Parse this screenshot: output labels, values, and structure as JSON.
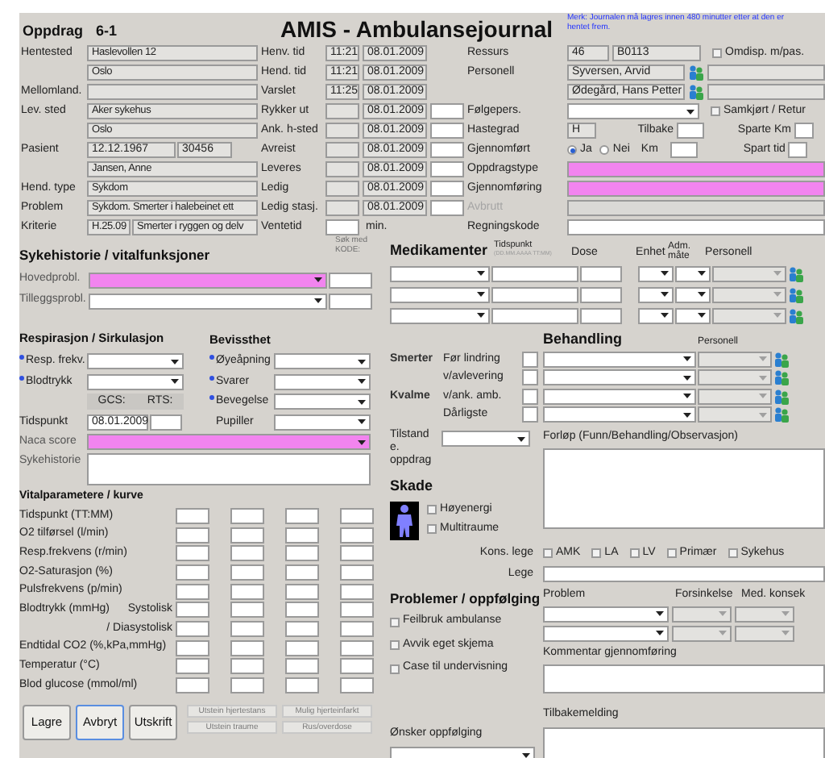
{
  "header": {
    "assignment_label": "Oppdrag",
    "assignment_number": "6-1",
    "title": "AMIS - Ambulansejournal",
    "note": "Merk: Journalen må lagres innen 480 minutter etter at den er hentet frem."
  },
  "location_rows": [
    {
      "kind": "text",
      "label": "Hentested",
      "values": [
        "Haslevollen  12"
      ]
    },
    {
      "kind": "text",
      "values": [
        "Oslo"
      ]
    },
    {
      "kind": "text",
      "label": "Mellomland."
    },
    {
      "kind": "text",
      "label": "Lev. sted",
      "values": [
        "Aker sykehus"
      ]
    },
    {
      "kind": "text",
      "values": [
        "Oslo"
      ]
    },
    {
      "kind": "pair",
      "label": "Pasient",
      "values": [
        "12.12.1967",
        "30456"
      ]
    },
    {
      "kind": "text",
      "values": [
        "Jansen, Anne"
      ]
    },
    {
      "kind": "text",
      "label": "Hend. type",
      "values": [
        "Sykdom"
      ]
    },
    {
      "kind": "text",
      "label": "Problem",
      "values": [
        "Sykdom. Smerter i halebeinet ett"
      ]
    },
    {
      "kind": "code",
      "label": "Kriterie",
      "values": [
        "H.25.09",
        "Smerter i ryggen og delv"
      ]
    }
  ],
  "time_rows": [
    {
      "kind": "timestamp",
      "label": "Henv. tid",
      "time": "11:21",
      "date": "08.01.2009"
    },
    {
      "kind": "timestamp",
      "label": "Hend. tid",
      "time": "11:21",
      "date": "08.01.2009"
    },
    {
      "kind": "timestamp",
      "label": "Varslet",
      "time": "11:25",
      "date": "08.01.2009"
    },
    {
      "kind": "timestamp_input",
      "label": "Rykker ut",
      "date": "08.01.2009"
    },
    {
      "kind": "timestamp_input",
      "label": "Ank. h-sted",
      "date": "08.01.2009"
    },
    {
      "kind": "timestamp_input",
      "label": "Avreist",
      "date": "08.01.2009"
    },
    {
      "kind": "timestamp_input",
      "label": "Leveres",
      "date": "08.01.2009"
    },
    {
      "kind": "timestamp_input",
      "label": "Ledig",
      "date": "08.01.2009"
    },
    {
      "kind": "timestamp_input",
      "label": "Ledig stasj.",
      "date": "08.01.2009"
    },
    {
      "kind": "duration",
      "label": "Ventetid",
      "unit": "min."
    }
  ],
  "resource": {
    "label": "Ressurs",
    "values": [
      "46",
      "B0113"
    ],
    "checkbox": {
      "label": "Omdisp. m/pas.",
      "checked": false
    }
  },
  "personnel": {
    "label": "Personell",
    "members": [
      "Syversen, Arvid",
      "Ødegård, Hans Petter"
    ]
  },
  "companion": {
    "label": "Følgepers.",
    "checkbox": {
      "label": "Samkjørt / Retur",
      "checked": false
    }
  },
  "urgency": {
    "label": "Hastegrad",
    "value": "H",
    "return_label": "Tilbake",
    "saved_km_label": "Sparte Km"
  },
  "completed": {
    "label": "Gjennomført",
    "options": [
      {
        "label": "Ja",
        "selected": true
      },
      {
        "label": "Nei",
        "selected": false
      }
    ],
    "km_label": "Km",
    "saved_time_label": "Spart tid"
  },
  "assignment_fields": [
    {
      "label": "Oppdragstype",
      "required": true,
      "disabled": false
    },
    {
      "label": "Gjennomføring",
      "required": true,
      "disabled": false
    },
    {
      "label": "Avbrutt",
      "required": false,
      "disabled": true
    },
    {
      "label": "Regningskode",
      "required": false,
      "disabled": false
    }
  ],
  "history": {
    "title": "Sykehistorie / vitalfunksjoner",
    "code_hint": "Søk med KODE:",
    "problems": [
      {
        "label": "Hovedprobl.",
        "required": true
      },
      {
        "label": "Tilleggsprobl.",
        "required": false
      }
    ]
  },
  "respiration": {
    "title": "Respirasjon / Sirkulasjon",
    "fields": [
      {
        "label": "Resp. frekv.",
        "starred": true
      },
      {
        "label": "Blodtrykk",
        "starred": true
      }
    ],
    "gcs_label": "GCS:",
    "rts_label": "RTS:",
    "time_label": "Tidspunkt",
    "time_date": "08.01.2009"
  },
  "consciousness": {
    "title": "Bevissthet",
    "fields": [
      {
        "label": "Øyeåpning",
        "starred": true
      },
      {
        "label": "Svarer",
        "starred": true
      },
      {
        "label": "Bevegelse",
        "starred": true
      },
      {
        "label": "Pupiller",
        "starred": false
      }
    ]
  },
  "naca": {
    "label": "Naca score",
    "required": true
  },
  "history_text": {
    "label": "Sykehistorie"
  },
  "vitals": {
    "title": "Vitalparametere / kurve",
    "rows": [
      {
        "label": "Tidspunkt (TT:MM)"
      },
      {
        "label": "O2 tilførsel (l/min)"
      },
      {
        "label": "Resp.frekvens (r/min)"
      },
      {
        "label": "O2-Saturasjon (%)"
      },
      {
        "label": "Pulsfrekvens (p/min)"
      },
      {
        "label": "Blodtrykk (mmHg)",
        "sublabel": "Systolisk"
      },
      {
        "sublabel": "/ Diasystolisk"
      },
      {
        "label": "Endtidal CO2 (%,kPa,mmHg)"
      },
      {
        "label": "Temperatur (°C)"
      },
      {
        "label": "Blod glucose (mmol/ml)"
      }
    ]
  },
  "buttons": [
    {
      "label": "Lagre",
      "focused": false
    },
    {
      "label": "Avbryt",
      "focused": true
    },
    {
      "label": "Utskrift",
      "focused": false
    }
  ],
  "form_buttons": [
    {
      "label": "Utstein hjertestans",
      "disabled": true
    },
    {
      "label": "Mulig hjerteinfarkt",
      "disabled": true
    },
    {
      "label": "Utstein traume",
      "disabled": true
    },
    {
      "label": "Rus/overdose",
      "disabled": true
    }
  ],
  "medication": {
    "title": "Medikamenter",
    "time_label": "Tidspunkt",
    "time_format": "(DD.MM.AAAA TT:MM)",
    "dose_label": "Dose",
    "unit_label": "Enhet",
    "route_label": "Adm. måte",
    "personnel_label": "Personell"
  },
  "pain": {
    "pain_label": "Smerter",
    "nausea_label": "Kvalme",
    "items": [
      "Før lindring",
      "v/avlevering",
      "v/ank. amb.",
      "Dårligste"
    ]
  },
  "treatment": {
    "title": "Behandling",
    "personnel_label": "Personell"
  },
  "condition": {
    "label": "Tilstand e. oppdrag"
  },
  "progress": {
    "label": "Forløp (Funn/Behandling/Observasjon)"
  },
  "injury": {
    "title": "Skade",
    "options": [
      {
        "label": "Høyenergi",
        "checked": false
      },
      {
        "label": "Multitraume",
        "checked": false
      }
    ]
  },
  "consultant": {
    "label": "Kons. lege",
    "options": [
      {
        "label": "AMK",
        "checked": false
      },
      {
        "label": "LA",
        "checked": false
      },
      {
        "label": "LV",
        "checked": false
      },
      {
        "label": "Primær",
        "checked": false
      },
      {
        "label": "Sykehus",
        "checked": false
      }
    ]
  },
  "doctor": {
    "label": "Lege"
  },
  "problems": {
    "title": "Problemer / oppfølging",
    "options": [
      {
        "label": "Feilbruk ambulanse",
        "checked": false
      },
      {
        "label": "Avvik eget skjema",
        "checked": false
      },
      {
        "label": "Case til undervisning",
        "checked": false
      }
    ],
    "columns": [
      "Problem",
      "Forsinkelse",
      "Med. konsek"
    ]
  },
  "comment": {
    "label": "Kommentar gjennomføring"
  },
  "feedback": {
    "label": "Tilbakemelding"
  },
  "follow_up": {
    "label": "Ønsker oppfølging"
  }
}
